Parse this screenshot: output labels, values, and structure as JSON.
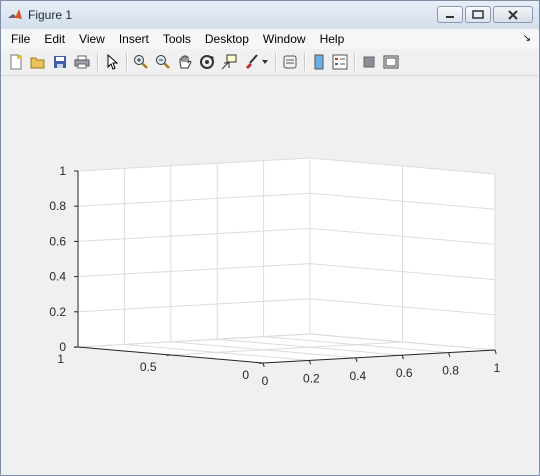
{
  "window": {
    "title": "Figure 1"
  },
  "menu": {
    "items": [
      "File",
      "Edit",
      "View",
      "Insert",
      "Tools",
      "Desktop",
      "Window",
      "Help"
    ]
  },
  "toolbar": {
    "icons": [
      "new-figure-icon",
      "open-file-icon",
      "save-icon",
      "print-icon",
      "pointer-icon",
      "zoom-in-icon",
      "zoom-out-icon",
      "pan-icon",
      "rotate-3d-icon",
      "data-cursor-icon",
      "brush-icon",
      "brush-dropdown-icon",
      "link-plot-icon",
      "colorbar-icon",
      "legend-icon",
      "hide-plot-tools-icon",
      "show-plot-tools-icon"
    ]
  },
  "chart_data": {
    "type": "3d-axes-empty",
    "title": "",
    "xlabel": "",
    "ylabel": "",
    "zlabel": "",
    "x_ticks": [
      "0",
      "0.2",
      "0.4",
      "0.6",
      "0.8",
      "1"
    ],
    "y_ticks": [
      "0",
      "0.5",
      "1"
    ],
    "z_ticks": [
      "0",
      "0.2",
      "0.4",
      "0.6",
      "0.8",
      "1"
    ],
    "xlim": [
      0,
      1
    ],
    "ylim": [
      0,
      1
    ],
    "zlim": [
      0,
      1
    ],
    "grid": true,
    "series": []
  },
  "colors": {
    "axis_line": "#262626",
    "grid_line": "#dcdcdc",
    "plot_bg": "#ffffff"
  }
}
